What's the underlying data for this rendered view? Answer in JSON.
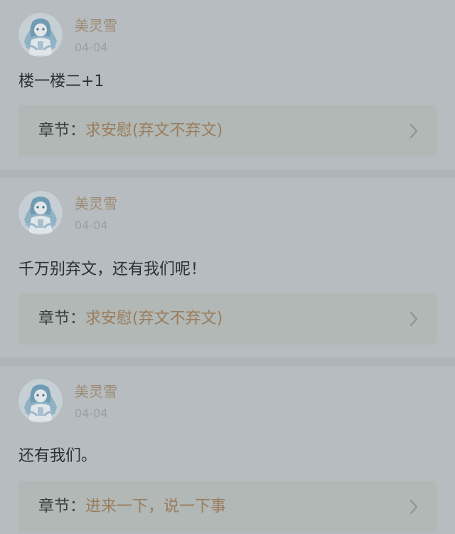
{
  "colors": {
    "username": "#9c8a73",
    "date": "#98a0a3",
    "chapter_title": "#9b7c5c",
    "chapter_label": "#3a4042",
    "text": "#2c3134"
  },
  "comments": [
    {
      "username": "美灵雪",
      "date": "04-04",
      "content": "楼一楼二+1",
      "chapter_label": "章节：",
      "chapter_title": "求安慰(弃文不弃文)",
      "avatar_icon": "anime-avatar-icon",
      "chevron_icon": "chevron-right-icon"
    },
    {
      "username": "美灵雪",
      "date": "04-04",
      "content": "千万别弃文，还有我们呢！",
      "chapter_label": "章节：",
      "chapter_title": "求安慰(弃文不弃文)",
      "avatar_icon": "anime-avatar-icon",
      "chevron_icon": "chevron-right-icon"
    },
    {
      "username": "美灵雪",
      "date": "04-04",
      "content": "还有我们。",
      "chapter_label": "章节：",
      "chapter_title": "进来一下，说一下事",
      "avatar_icon": "anime-avatar-icon",
      "chevron_icon": "chevron-right-icon"
    }
  ]
}
